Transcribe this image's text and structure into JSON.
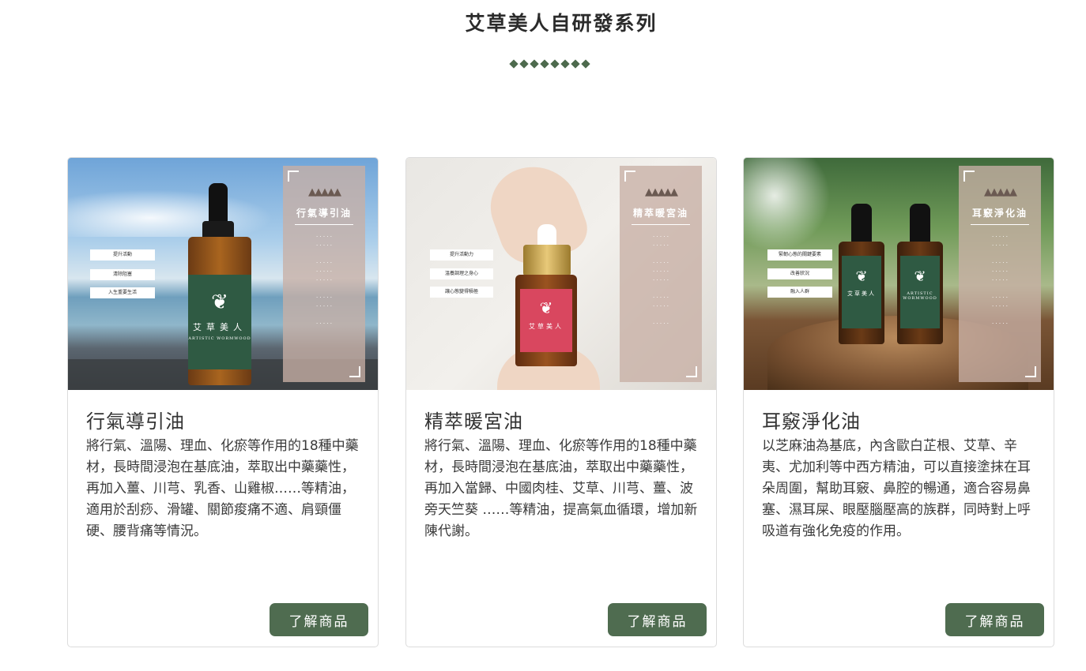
{
  "section": {
    "title": "艾草美人自研發系列",
    "divider_count": 8
  },
  "products": [
    {
      "title": "行氣導引油",
      "description": "將行氣、溫陽、理血、化瘀等作用的18種中藥材，長時間浸泡在基底油，萃取出中藥藥性，再加入薑、川芎、乳香、山雞椒……等精油，適用於刮痧、滑罐、關節痠痛不適、肩頸僵硬、腰背痛等情況。",
      "button_label": "了解商品",
      "image": {
        "panel_title": "行氣導引油",
        "bottle_label": "艾草美人",
        "bottle_sub": "ARTISTIC WORMWOOD"
      }
    },
    {
      "title": "精萃暖宮油",
      "description": "將行氣、溫陽、理血、化瘀等作用的18種中藥材，長時間浸泡在基底油，萃取出中藥藥性，再加入當歸、中國肉桂、艾草、川芎、薑、波旁天竺葵 ……等精油，提高氣血循環，增加新陳代謝。",
      "button_label": "了解商品",
      "image": {
        "panel_title": "精萃暖宮油",
        "bottle_label": "艾草美人",
        "bottle_sub": ""
      }
    },
    {
      "title": "耳竅淨化油",
      "description": "以芝麻油為基底，內含歐白芷根、艾草、辛夷、尤加利等中西方精油，可以直接塗抹在耳朵周圍，幫助耳竅、鼻腔的暢通，適合容易鼻塞、濕耳屎、眼壓腦壓高的族群，同時對上呼吸道有強化免疫的作用。",
      "button_label": "了解商品",
      "image": {
        "panel_title": "耳竅淨化油",
        "bottle_label": "艾草美人",
        "bottle_sub": "ARTISTIC WORMWOOD"
      }
    }
  ],
  "colors": {
    "accent_green": "#4f6c50",
    "diamond_green": "#4d6a4d",
    "card_border": "#dcdcdc"
  }
}
